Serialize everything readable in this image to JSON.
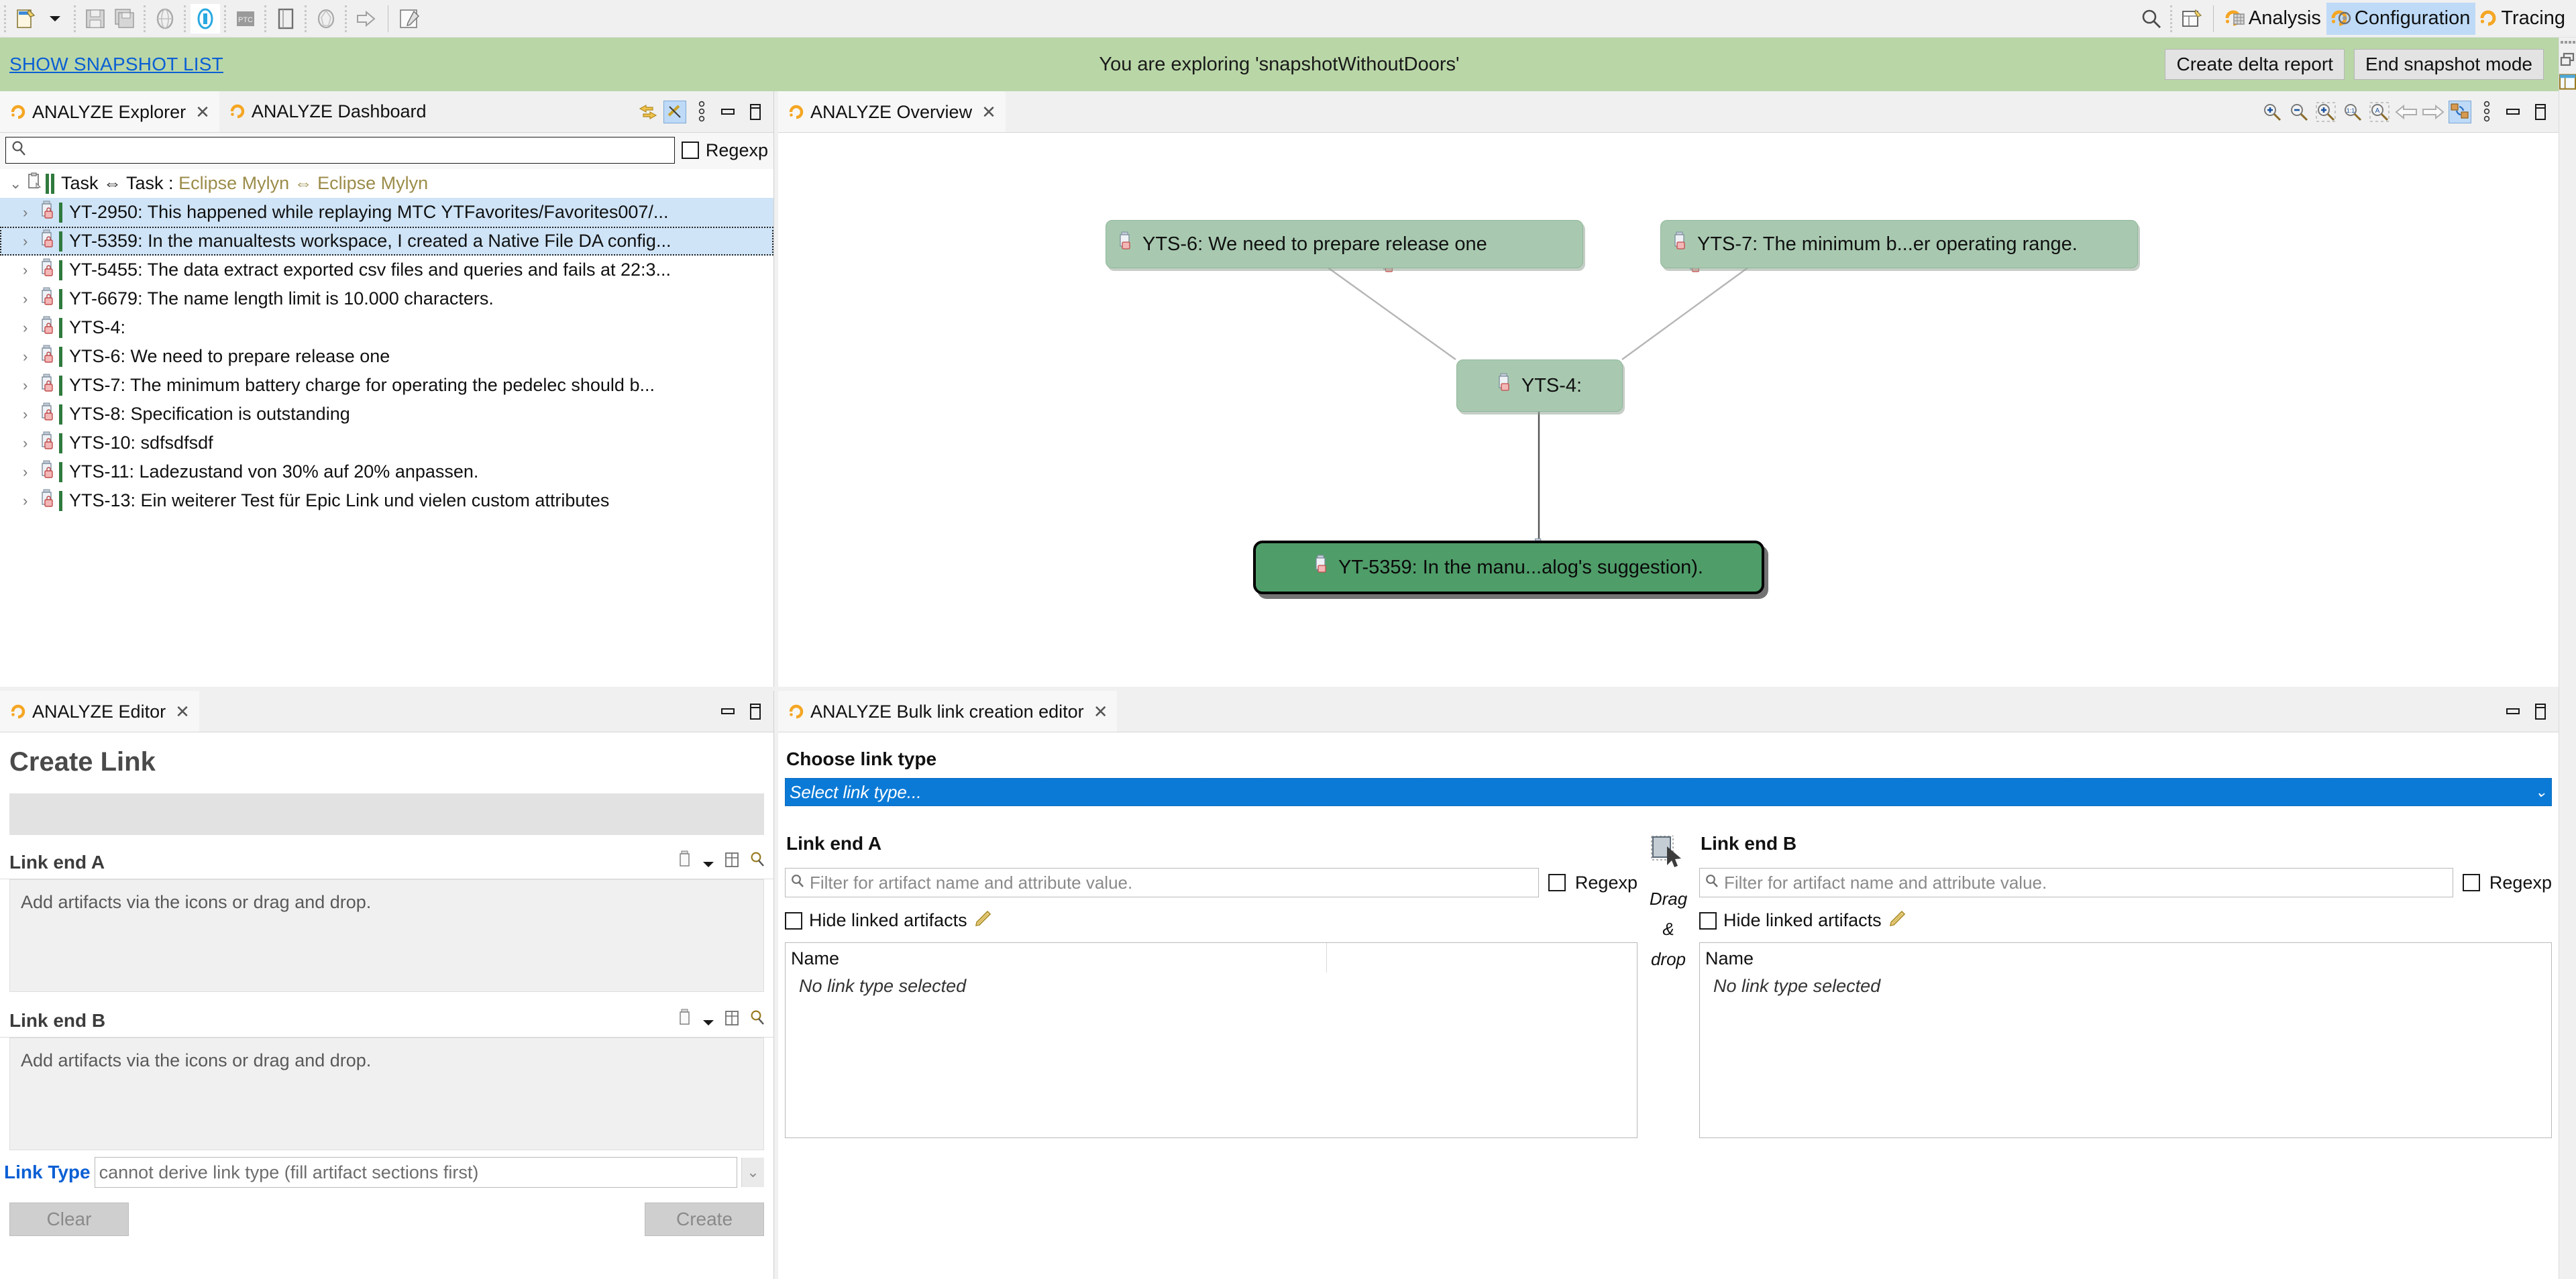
{
  "toolbar": {
    "icons": [
      {
        "name": "new-wizard-icon",
        "label": "New"
      },
      {
        "name": "chevron-down-icon",
        "label": "New dropdown"
      },
      {
        "name": "save-icon",
        "label": "Save"
      },
      {
        "name": "save-all-icon",
        "label": "Save All"
      },
      {
        "name": "globe-icon",
        "label": "Global"
      },
      {
        "name": "highlight-active-icon",
        "label": "Highlighted"
      },
      {
        "name": "ptc-icon",
        "label": "PTC"
      },
      {
        "name": "door-icon",
        "label": "DOORS"
      },
      {
        "name": "network-icon",
        "label": "Network"
      },
      {
        "name": "export-icon",
        "label": "Export"
      },
      {
        "name": "edit-note-icon",
        "label": "Edit note"
      }
    ],
    "search_icon": "search-icon",
    "open-perspective-icon": "open-perspective-icon",
    "perspectives": [
      {
        "label": "Analysis",
        "active": false,
        "icon": "analysis-perspective-icon"
      },
      {
        "label": "Configuration",
        "active": true,
        "icon": "configuration-perspective-icon"
      },
      {
        "label": "Tracing",
        "active": false,
        "icon": "tracing-perspective-icon"
      }
    ]
  },
  "snapshot_bar": {
    "link_label": "SHOW SNAPSHOT LIST",
    "message": "You are exploring 'snapshotWithoutDoors'",
    "create_delta_report": "Create delta report",
    "end_snapshot_mode": "End snapshot mode",
    "background_color": "#b9d6a7",
    "link_color": "#0a5fd4"
  },
  "explorer": {
    "tabs": [
      {
        "label": "ANALYZE Explorer",
        "active": true,
        "closable": true
      },
      {
        "label": "ANALYZE Dashboard",
        "active": false,
        "closable": false
      }
    ],
    "search": {
      "value": "",
      "placeholder": ""
    },
    "regexp_label": "Regexp",
    "regexp_checked": false,
    "tree": {
      "root": {
        "label_plain": "Task ⇔ Task : ",
        "label_accent": "Eclipse Mylyn ⇔ Eclipse Mylyn",
        "expanded": true
      },
      "items": [
        {
          "label": "YT-2950: This happened while replaying MTC YTFavorites/Favorites007/...",
          "state": "highlighted"
        },
        {
          "label": "YT-5359: In the manualtests workspace, I created a Native File DA config...",
          "state": "selected"
        },
        {
          "label": "YT-5455: The data extract exported csv files and queries and fails at 22:3...",
          "state": "normal"
        },
        {
          "label": "YT-6679: The name length limit is 10.000 characters.",
          "state": "normal"
        },
        {
          "label": "YTS-4:",
          "state": "normal"
        },
        {
          "label": "YTS-6: We need to prepare release one",
          "state": "normal"
        },
        {
          "label": "YTS-7: The minimum battery charge for operating the pedelec should b...",
          "state": "normal"
        },
        {
          "label": "YTS-8: Specification is outstanding",
          "state": "normal"
        },
        {
          "label": "YTS-10: sdfsdfsdf",
          "state": "normal"
        },
        {
          "label": "YTS-11: Ladezustand von 30% auf 20% anpassen.",
          "state": "normal"
        },
        {
          "label": "YTS-13: Ein weiterer Test für Epic Link und vielen custom attributes",
          "state": "normal"
        }
      ]
    }
  },
  "overview": {
    "tab": {
      "label": "ANALYZE Overview",
      "closable": true
    },
    "tools": [
      "zoom-in-icon",
      "zoom-out-icon",
      "zoom-selection-icon",
      "zoom-actual-icon",
      "zoom-fit-icon",
      "back-arrow-icon",
      "forward-arrow-icon",
      "link-layout-icon",
      "view-menu-icon",
      "minimize-icon",
      "maximize-icon"
    ],
    "graph": {
      "nodes": [
        {
          "id": "YTS-6",
          "label": "YTS-6: We need to prepare release one",
          "selected": false
        },
        {
          "id": "YTS-7",
          "label": "YTS-7: The minimum b...er operating range.",
          "selected": false
        },
        {
          "id": "YTS-4",
          "label": "YTS-4:",
          "selected": false
        },
        {
          "id": "YT-5359",
          "label": "YT-5359: In the manu...alog's suggestion).",
          "selected": true
        }
      ],
      "edges": [
        {
          "from": "YTS-6",
          "to": "YTS-4"
        },
        {
          "from": "YTS-7",
          "to": "YTS-4"
        },
        {
          "from": "YTS-4",
          "to": "YT-5359"
        }
      ],
      "node_color": "#a8c9b0",
      "selected_node_color": "#4f9d69"
    }
  },
  "editor": {
    "tab": {
      "label": "ANALYZE Editor",
      "closable": true
    },
    "title": "Create Link",
    "link_end_a": {
      "heading": "Link end A",
      "placeholder": "Add artifacts via the icons or drag and drop."
    },
    "link_end_b": {
      "heading": "Link end B",
      "placeholder": "Add artifacts via the icons or drag and drop."
    },
    "link_type": {
      "label": "Link Type",
      "value": "cannot derive link type (fill artifact sections first)"
    },
    "clear_button": "Clear",
    "create_button": "Create"
  },
  "bulk": {
    "tab": {
      "label": "ANALYZE Bulk link creation editor",
      "closable": true
    },
    "choose_link_type_heading": "Choose link type",
    "select_link_type_value": "Select link type...",
    "end_a": {
      "heading": "Link end A",
      "filter_placeholder": "Filter for artifact name and attribute value.",
      "regexp_label": "Regexp",
      "regexp_checked": false,
      "hide_linked_label": "Hide linked artifacts",
      "hide_linked_checked": false,
      "column_header": "Name",
      "empty_text": "No link type selected"
    },
    "end_b": {
      "heading": "Link end B",
      "filter_placeholder": "Filter for artifact name and attribute value.",
      "regexp_label": "Regexp",
      "regexp_checked": false,
      "hide_linked_label": "Hide linked artifacts",
      "hide_linked_checked": false,
      "column_header": "Name",
      "empty_text": "No link type selected"
    },
    "dragdrop": {
      "line1": "Drag",
      "line2": "&",
      "line3": "drop"
    }
  }
}
